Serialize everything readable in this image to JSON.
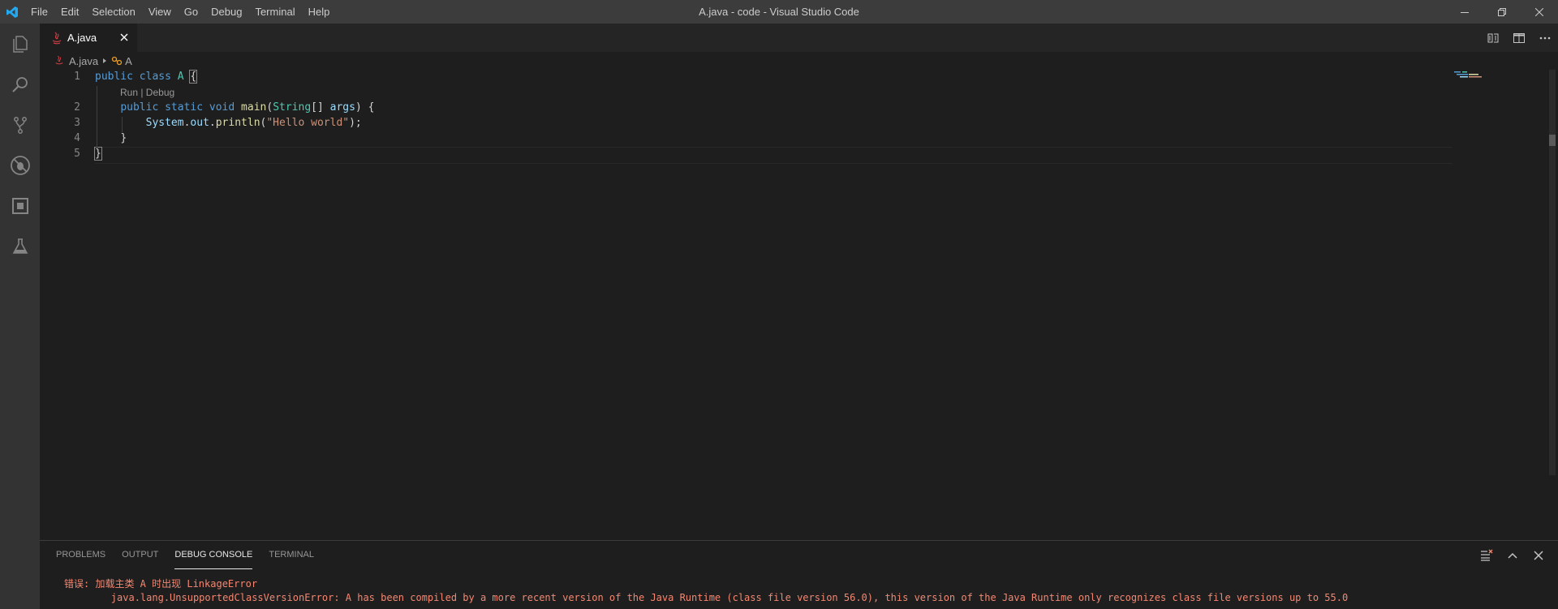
{
  "window": {
    "title": "A.java - code - Visual Studio Code",
    "menu": [
      "File",
      "Edit",
      "Selection",
      "View",
      "Go",
      "Debug",
      "Terminal",
      "Help"
    ]
  },
  "activity_bar": {
    "items": [
      "files-icon",
      "search-icon",
      "source-control-icon",
      "debug-icon",
      "extensions-icon",
      "test-icon"
    ]
  },
  "tabs": [
    {
      "label": "A.java",
      "active": true
    }
  ],
  "breadcrumb": {
    "file": "A.java",
    "symbol": "A"
  },
  "editor": {
    "line_numbers": [
      "1",
      "2",
      "3",
      "4",
      "5"
    ],
    "codelens": "Run | Debug",
    "code": {
      "line1": {
        "kw1": "public",
        "kw2": "class",
        "name": "A",
        "brace": "{"
      },
      "line2": {
        "kw1": "public",
        "kw2": "static",
        "kw3": "void",
        "method": "main",
        "open": "(",
        "type": "String",
        "arr": "[]",
        "arg": "args",
        "close": ") {"
      },
      "line3": {
        "obj": "System",
        "dot1": ".",
        "field": "out",
        "dot2": ".",
        "method": "println",
        "open": "(",
        "str": "\"Hello world\"",
        "close": ");"
      },
      "line4": {
        "brace": "}"
      },
      "line5": {
        "brace": "}"
      }
    }
  },
  "panel": {
    "tabs": [
      "PROBLEMS",
      "OUTPUT",
      "DEBUG CONSOLE",
      "TERMINAL"
    ],
    "active_tab": "DEBUG CONSOLE",
    "output": [
      "错误: 加载主类 A 时出现 LinkageError",
      "        java.lang.UnsupportedClassVersionError: A has been compiled by a more recent version of the Java Runtime (class file version 56.0), this version of the Java Runtime only recognizes class file versions up to 55.0"
    ]
  },
  "colors": {
    "accent": "#007acc",
    "error": "#f48771",
    "keyword": "#569cd6",
    "type": "#4ec9b0",
    "string": "#ce9178"
  }
}
